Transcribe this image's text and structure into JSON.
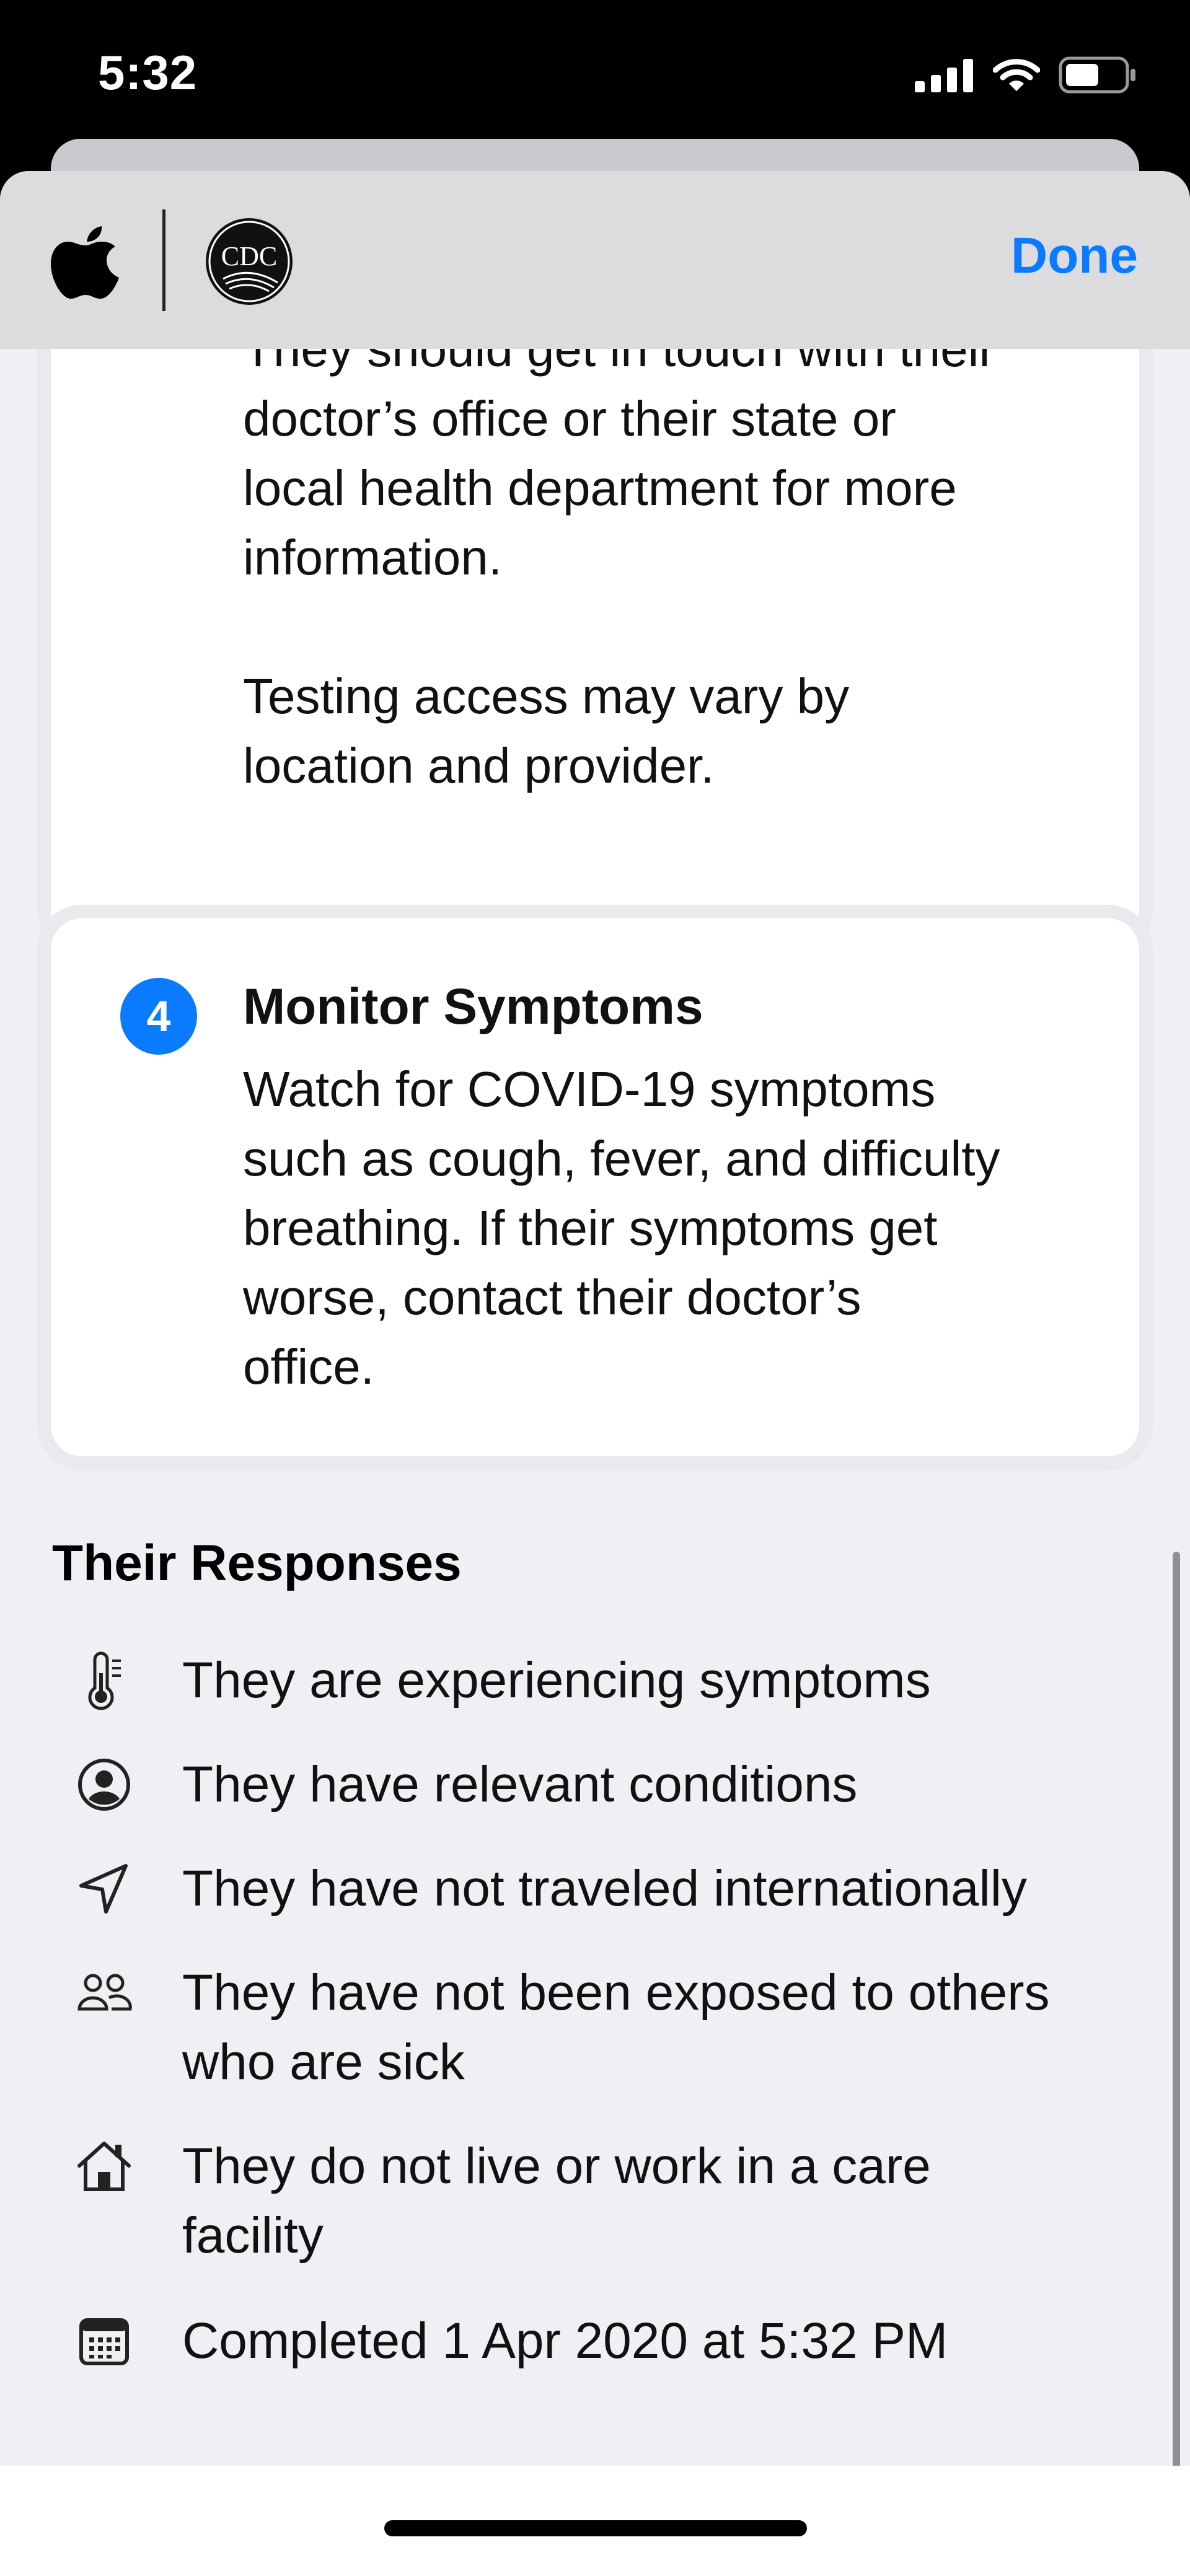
{
  "status_bar": {
    "time": "5:32"
  },
  "nav": {
    "done_label": "Done",
    "logos": {
      "apple": "apple-logo",
      "cdc": "CDC"
    }
  },
  "cards": {
    "step3": {
      "body": "They should get in touch with their\ndoctor’s office or their state or\nlocal health department for more\ninformation.\n\nTesting access may vary by\nlocation and provider."
    },
    "step4": {
      "number": "4",
      "title": "Monitor Symptoms",
      "body": "Watch for COVID-19 symptoms\nsuch as cough, fever, and difficulty\nbreathing. If their symptoms get\nworse, contact their doctor’s\noffice."
    }
  },
  "responses": {
    "heading": "Their Responses",
    "items": [
      {
        "icon": "thermometer-icon",
        "text": "They are experiencing symptoms"
      },
      {
        "icon": "person-circle-icon",
        "text": "They have relevant conditions"
      },
      {
        "icon": "location-arrow-icon",
        "text": "They have not traveled internationally"
      },
      {
        "icon": "people-icon",
        "text": "They have not been exposed to others\nwho are sick"
      },
      {
        "icon": "house-icon",
        "text": "They do not live or work in a care\nfacility"
      },
      {
        "icon": "calendar-icon",
        "text": "Completed 1 Apr 2020 at 5:32 PM"
      }
    ]
  },
  "colors": {
    "accent": "#0a7aff",
    "background": "#efeff4",
    "card": "#ffffff",
    "navbar": "#dcdcdf"
  }
}
